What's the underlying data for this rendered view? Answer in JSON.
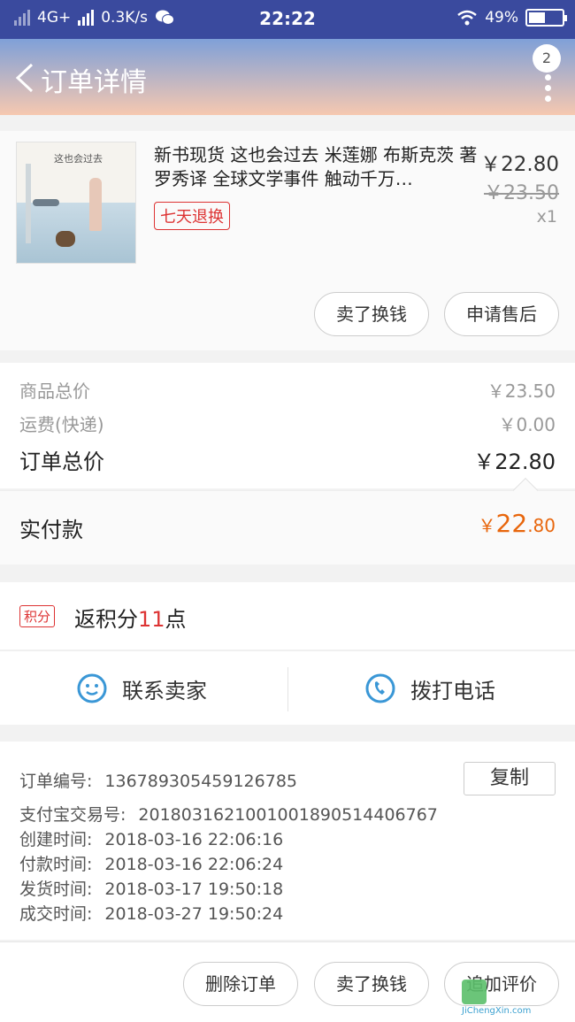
{
  "status_bar": {
    "network": "4G+",
    "speed": "0.3K/s",
    "time": "22:22",
    "battery": "49%",
    "battery_level": 0.49
  },
  "header": {
    "title": "订单详情",
    "badge_count": "2"
  },
  "product": {
    "title": "新书现货 这也会过去 米莲娜 布斯克茨 著 罗秀译 全球文学事件 触动千万…",
    "cover_title": "这也会过去",
    "tag": "七天退换",
    "price": "￥22.80",
    "original_price": "￥23.50",
    "quantity": "x1",
    "actions": {
      "sell": "卖了换钱",
      "after_sale": "申请售后"
    }
  },
  "summary": {
    "goods_total_label": "商品总价",
    "goods_total_value": "￥23.50",
    "shipping_label": "运费(快递)",
    "shipping_value": "￥0.00",
    "order_total_label": "订单总价",
    "order_total_value": "￥22.80"
  },
  "payment": {
    "label": "实付款",
    "currency": "￥",
    "integer": "22",
    "decimal": ".80"
  },
  "points": {
    "tag": "积分",
    "prefix": "返积分",
    "value": "11",
    "suffix": "点"
  },
  "contact": {
    "seller": "联系卖家",
    "phone": "拨打电话"
  },
  "order_info": {
    "order_no_label": "订单编号:",
    "order_no": "136789305459126785",
    "copy_label": "复制",
    "alipay_label": "支付宝交易号:",
    "alipay_no": "2018031621001001890514406767",
    "created_label": "创建时间:",
    "created": "2018-03-16 22:06:16",
    "paid_label": "付款时间:",
    "paid": "2018-03-16 22:06:24",
    "shipped_label": "发货时间:",
    "shipped": "2018-03-17 19:50:18",
    "completed_label": "成交时间:",
    "completed": "2018-03-27 19:50:24"
  },
  "bottom_actions": {
    "delete": "删除订单",
    "sell": "卖了换钱",
    "review": "追加评价"
  },
  "watermark": {
    "text": "JiChengXin.com"
  },
  "colors": {
    "status_bar": "#3a4a9e",
    "accent_red": "#dd3333",
    "price_orange": "#e8660c",
    "icon_blue": "#3a97d6"
  }
}
